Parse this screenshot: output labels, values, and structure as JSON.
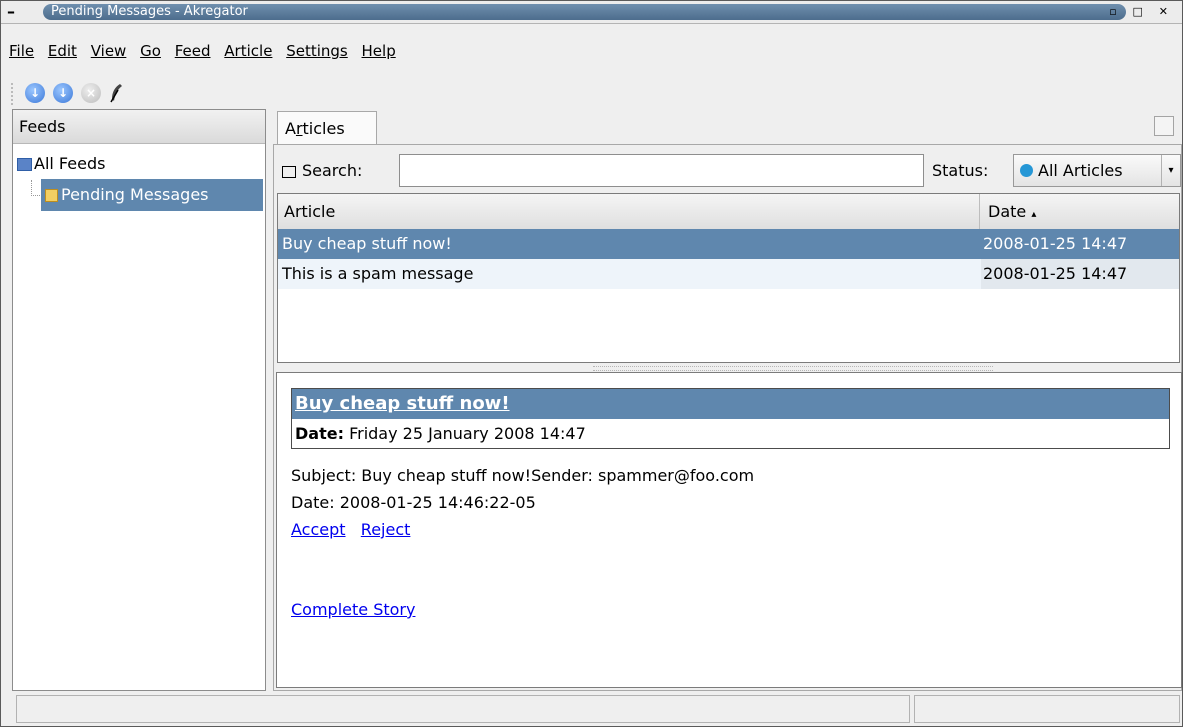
{
  "window": {
    "title": "Pending Messages - Akregator",
    "buttons": [
      "▫",
      "□",
      "✕"
    ],
    "minimize_glyph": "–"
  },
  "menu": {
    "items": [
      "File",
      "Edit",
      "View",
      "Go",
      "Feed",
      "Article",
      "Settings",
      "Help"
    ]
  },
  "toolbar": {
    "icons": [
      "fetch-feed-icon",
      "fetch-all-feeds-icon",
      "stop-icon",
      "feather-icon"
    ]
  },
  "feeds_panel": {
    "header": "Feeds",
    "items": [
      {
        "label": "All Feeds",
        "icon": "folder-icon"
      },
      {
        "label": "Pending Messages",
        "icon": "feed-icon",
        "selected": true
      }
    ]
  },
  "tab": {
    "label_prefix": "A",
    "label_underlined": "r",
    "label_suffix": "ticles"
  },
  "search": {
    "label": "Search:",
    "placeholder": "",
    "status_label": "Status:",
    "status_value": "All Articles"
  },
  "articles": {
    "headers": {
      "article": "Article",
      "date": "Date"
    },
    "rows": [
      {
        "title": "Buy cheap stuff now!",
        "date": "2008-01-25 14:47"
      },
      {
        "title": "This is a spam message",
        "date": "2008-01-25 14:47"
      }
    ]
  },
  "preview": {
    "title": "Buy cheap stuff now!",
    "date_label": "Date:",
    "date_value": "Friday 25 January 2008 14:47",
    "body_line1": "Subject: Buy cheap stuff now!Sender: spammer@foo.com",
    "body_line2": "Date: 2008-01-25 14:46:22-05",
    "accept": "Accept",
    "reject": "Reject",
    "complete_story": "Complete Story"
  },
  "colors": {
    "selection": "#5f87ae",
    "link": "#0000ee"
  }
}
